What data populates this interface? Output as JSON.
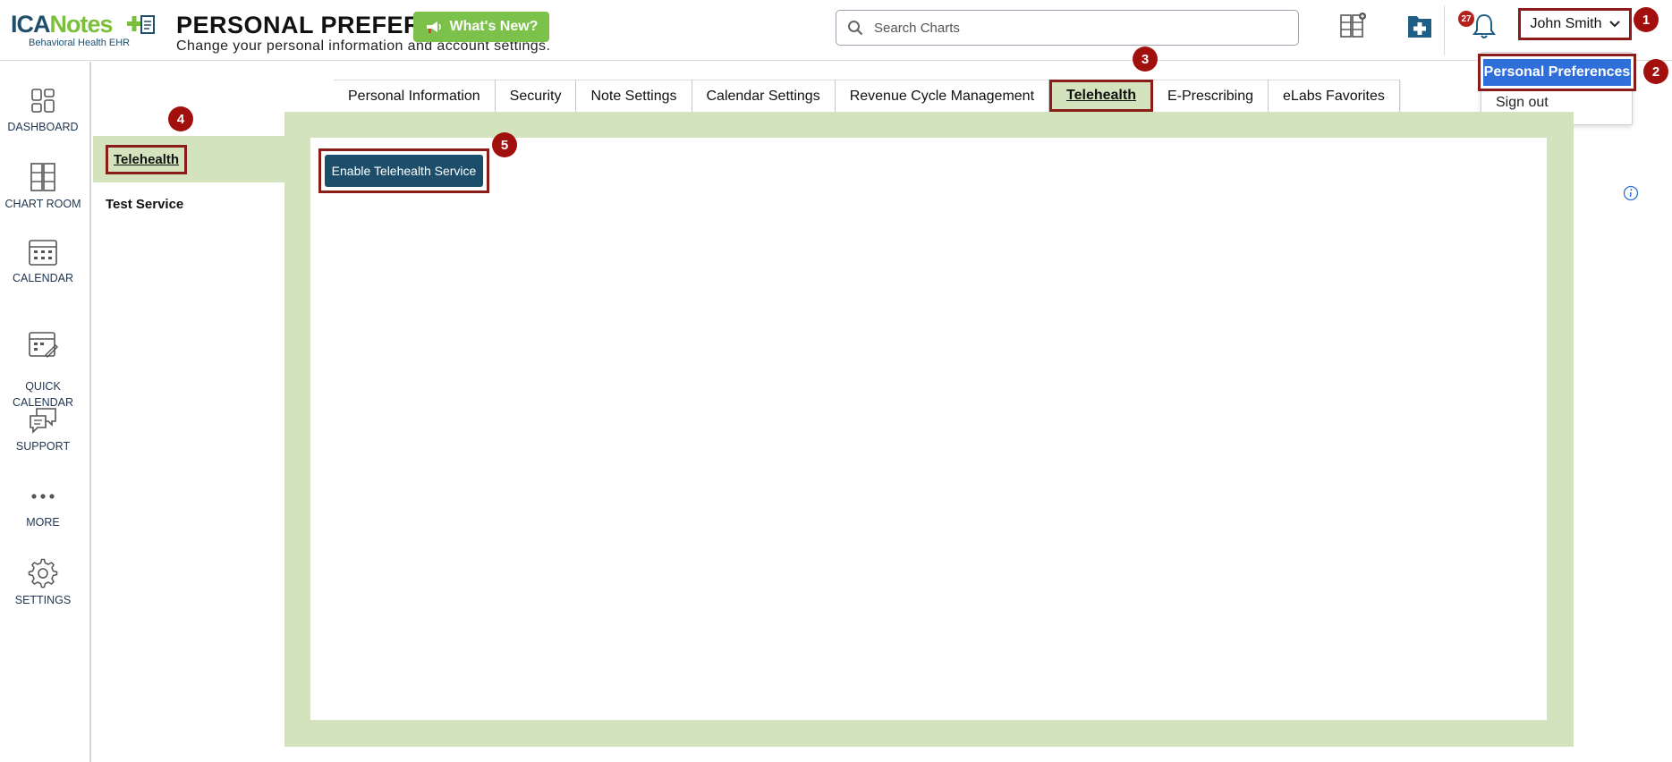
{
  "header": {
    "logo_ica": "ICA",
    "logo_notes": "Notes",
    "logo_subtitle": "Behavioral Health EHR",
    "title": "PERSONAL PREFERENCES",
    "subtitle": "Change your personal information and account settings.",
    "whats_new_label": "What's New?",
    "search_placeholder": "Search Charts",
    "notification_count": "27",
    "user_name": "John Smith"
  },
  "user_menu": {
    "items": [
      "Personal Preferences",
      "Sign out"
    ]
  },
  "steps": [
    "1",
    "2",
    "3",
    "4",
    "5"
  ],
  "leftnav": {
    "items": [
      {
        "label": "DASHBOARD",
        "icon": "dashboard-icon"
      },
      {
        "label": "CHART ROOM",
        "icon": "chart-room-icon"
      },
      {
        "label": "CALENDAR",
        "icon": "calendar-icon"
      },
      {
        "label": "QUICK\nCALENDAR",
        "icon": "quick-calendar-icon"
      },
      {
        "label": "SUPPORT",
        "icon": "support-icon"
      },
      {
        "label": "MORE",
        "icon": "more-icon"
      },
      {
        "label": "SETTINGS",
        "icon": "gear-icon"
      }
    ]
  },
  "tabs": [
    "Personal Information",
    "Security",
    "Note Settings",
    "Calendar Settings",
    "Revenue Cycle Management",
    "Telehealth",
    "E-Prescribing",
    "eLabs Favorites"
  ],
  "active_tab": "Telehealth",
  "sub_sidebar": {
    "items": [
      "Telehealth",
      "Test Service"
    ]
  },
  "content": {
    "enable_button_label": "Enable Telehealth Service"
  },
  "colors": {
    "accent_green": "#d3e3be",
    "button_blue": "#1c4e6b",
    "highlight_red": "#8a1c1a",
    "menu_blue": "#2f6fd9"
  }
}
